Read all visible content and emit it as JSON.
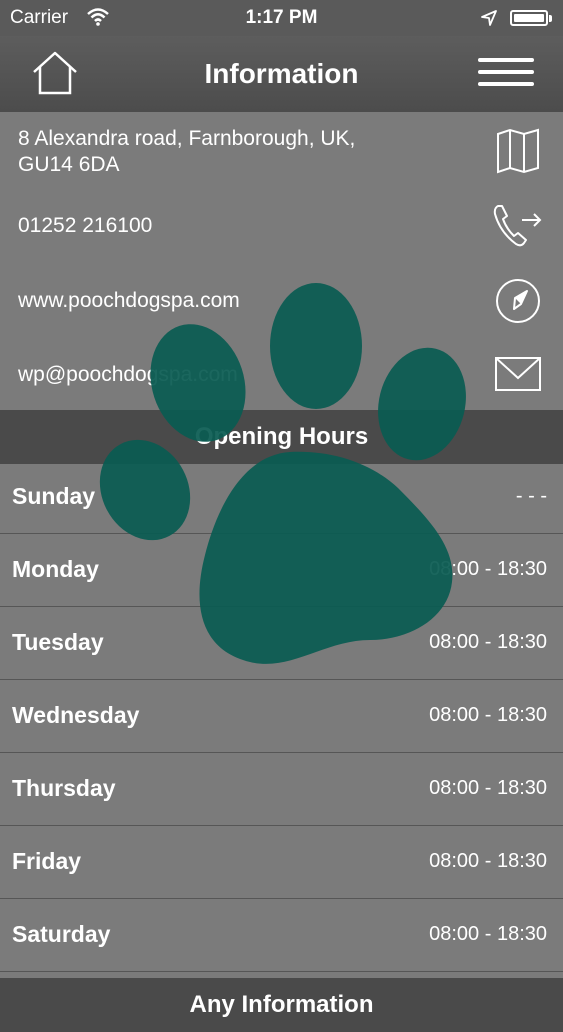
{
  "status_bar": {
    "carrier": "Carrier",
    "time": "1:17 PM"
  },
  "nav": {
    "title": "Information",
    "home_icon": "home-icon",
    "menu_icon": "hamburger-menu-icon"
  },
  "contact": {
    "address_line1": "8 Alexandra road, Farnborough, UK,",
    "address_line2": "GU14 6DA",
    "phone": "01252 216100",
    "website": "www.poochdogspa.com",
    "email": "wp@poochdogspa.com"
  },
  "opening_hours": {
    "header": "Opening Hours",
    "days": [
      {
        "day": "Sunday",
        "hours": "- - -"
      },
      {
        "day": "Monday",
        "hours": "08:00 - 18:30"
      },
      {
        "day": "Tuesday",
        "hours": "08:00 - 18:30"
      },
      {
        "day": "Wednesday",
        "hours": "08:00 - 18:30"
      },
      {
        "day": "Thursday",
        "hours": "08:00 - 18:30"
      },
      {
        "day": "Friday",
        "hours": "08:00 - 18:30"
      },
      {
        "day": "Saturday",
        "hours": "08:00 - 18:30"
      }
    ]
  },
  "next_section_header": "Any Information",
  "colors": {
    "paw": "#0a5b52",
    "background": "#7b7b7b",
    "header": "#4a4a4a"
  }
}
